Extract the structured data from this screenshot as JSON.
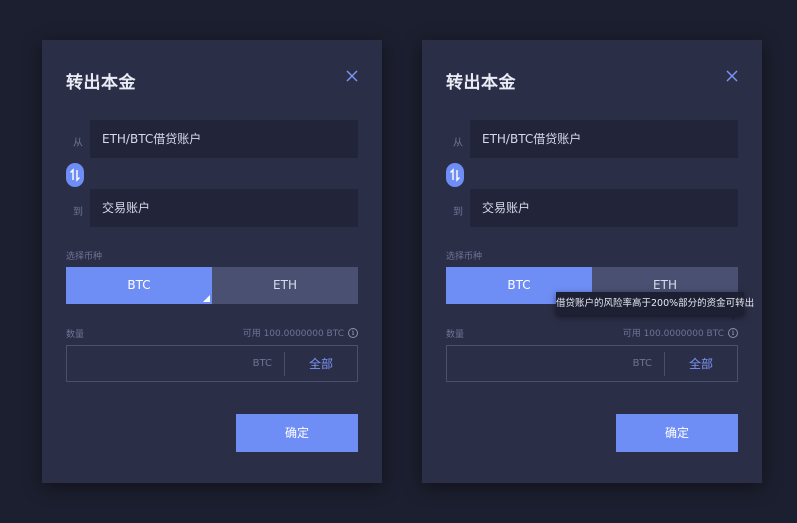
{
  "dialogs": [
    {
      "title": "转出本金",
      "from_label": "从",
      "from_account": "ETH/BTC借贷账户",
      "to_label": "到",
      "to_account": "交易账户",
      "currency_label": "选择币种",
      "currency_options": [
        "BTC",
        "ETH"
      ],
      "selected_currency": "BTC",
      "amount_label": "数量",
      "available_text": "可用 100.0000000 BTC",
      "amount_value": "",
      "unit": "BTC",
      "all_label": "全部",
      "confirm_label": "确定"
    },
    {
      "title": "转出本金",
      "from_label": "从",
      "from_account": "ETH/BTC借贷账户",
      "to_label": "到",
      "to_account": "交易账户",
      "currency_label": "选择币种",
      "currency_options": [
        "BTC",
        "ETH"
      ],
      "selected_currency": "BTC",
      "amount_label": "数量",
      "available_text": "可用 100.0000000 BTC",
      "amount_value": "",
      "unit": "BTC",
      "all_label": "全部",
      "confirm_label": "确定",
      "tooltip": "借贷账户的风险率高于200%部分的资金可转出"
    }
  ],
  "icons": {
    "close": "close-icon",
    "swap": "swap-arrows-icon",
    "info": "info-icon"
  },
  "colors": {
    "background": "#1c1f2f",
    "dialog": "#2b2e47",
    "accent": "#6e8ef5",
    "field": "#22253a"
  }
}
